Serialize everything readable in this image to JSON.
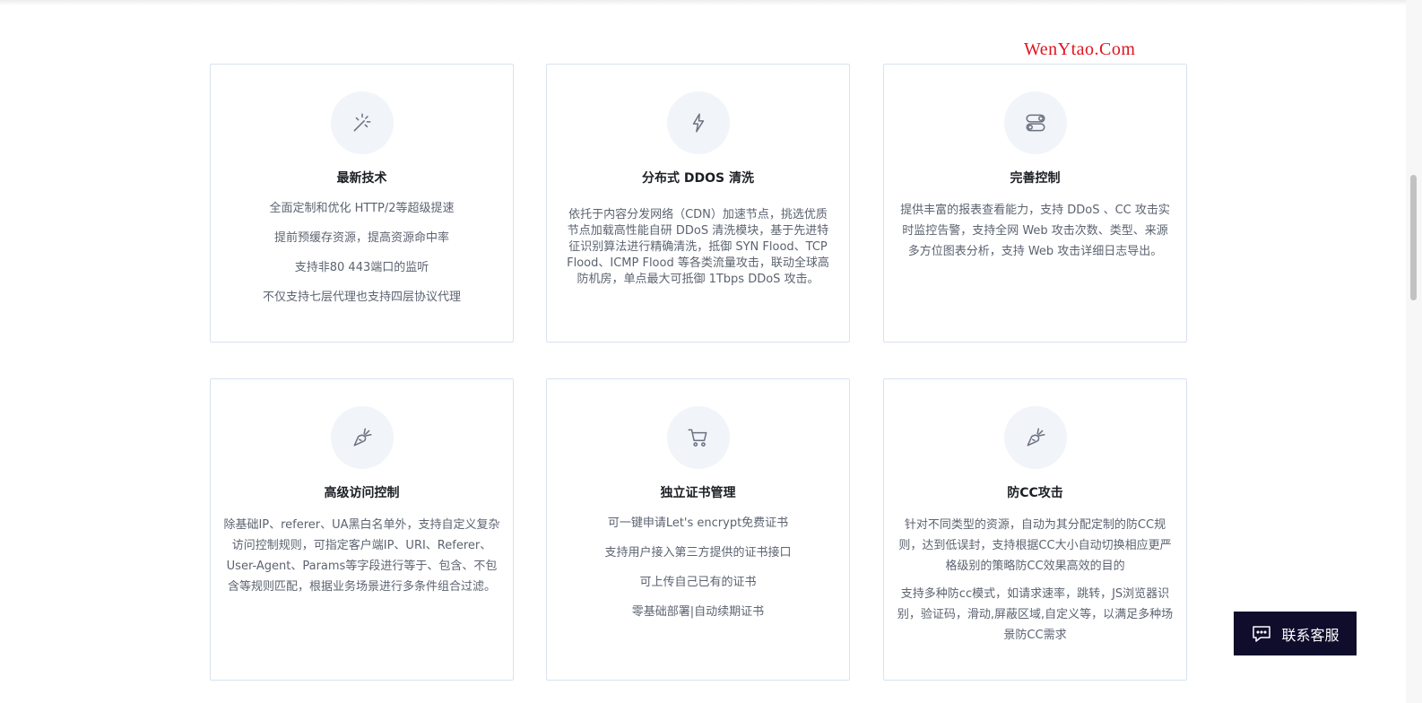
{
  "watermark": "WenYtao.Com",
  "colors": {
    "accent": "#0f0c2c",
    "border": "#d9e2f1",
    "icon_bg": "#f1f4f9",
    "watermark": "#e0141e"
  },
  "features": [
    {
      "icon": "magic-wand-icon",
      "title": "最新技术",
      "lines": [
        "全面定制和优化 HTTP/2等超级提速",
        "提前预缓存资源，提高资源命中率",
        "支持非80 443端口的监听",
        "不仅支持七层代理也支持四层协议代理"
      ]
    },
    {
      "icon": "lightning-icon",
      "title": "分布式 DDOS 清洗",
      "paragraph": "依托于内容分发网络（CDN）加速节点，挑选优质节点加载高性能自研 DDoS 清洗模块，基于先进特征识别算法进行精确清洗，抵御 SYN Flood、TCP Flood、ICMP Flood 等各类流量攻击，联动全球高防机房，单点最大可抵御 1Tbps DDoS 攻击。"
    },
    {
      "icon": "toggle-switch-icon",
      "title": "完善控制",
      "paragraph": "提供丰富的报表查看能力，支持 DDoS 、CC 攻击实时监控告警，支持全网 Web 攻击次数、类型、来源多方位图表分析，支持 Web 攻击详细日志导出。"
    },
    {
      "icon": "carrot-icon",
      "title": "高级访问控制",
      "paragraph": "除基础IP、referer、UA黑白名单外，支持自定义复杂访问控制规则，可指定客户端IP、URI、Referer、User-Agent、Params等字段进行等于、包含、不包含等规则匹配，根据业务场景进行多条件组合过滤。"
    },
    {
      "icon": "shopping-cart-icon",
      "title": "独立证书管理",
      "lines": [
        "可一键申请Let's encrypt免费证书",
        "支持用户接入第三方提供的证书接口",
        "可上传自己已有的证书",
        "零基础部署|自动续期证书"
      ]
    },
    {
      "icon": "carrot-icon",
      "title": "防CC攻击",
      "paragraphs": [
        "针对不同类型的资源，自动为其分配定制的防CC规则，达到低误封，支持根据CC大小自动切换相应更严格级别的策略防CC效果高效的目的",
        "支持多种防cc模式，如请求速率，跳转，JS浏览器识别，验证码，滑动,屏蔽区域,自定义等，以满足多种场景防CC需求"
      ]
    }
  ],
  "contact": {
    "label": "联系客服",
    "icon": "chat-icon"
  }
}
